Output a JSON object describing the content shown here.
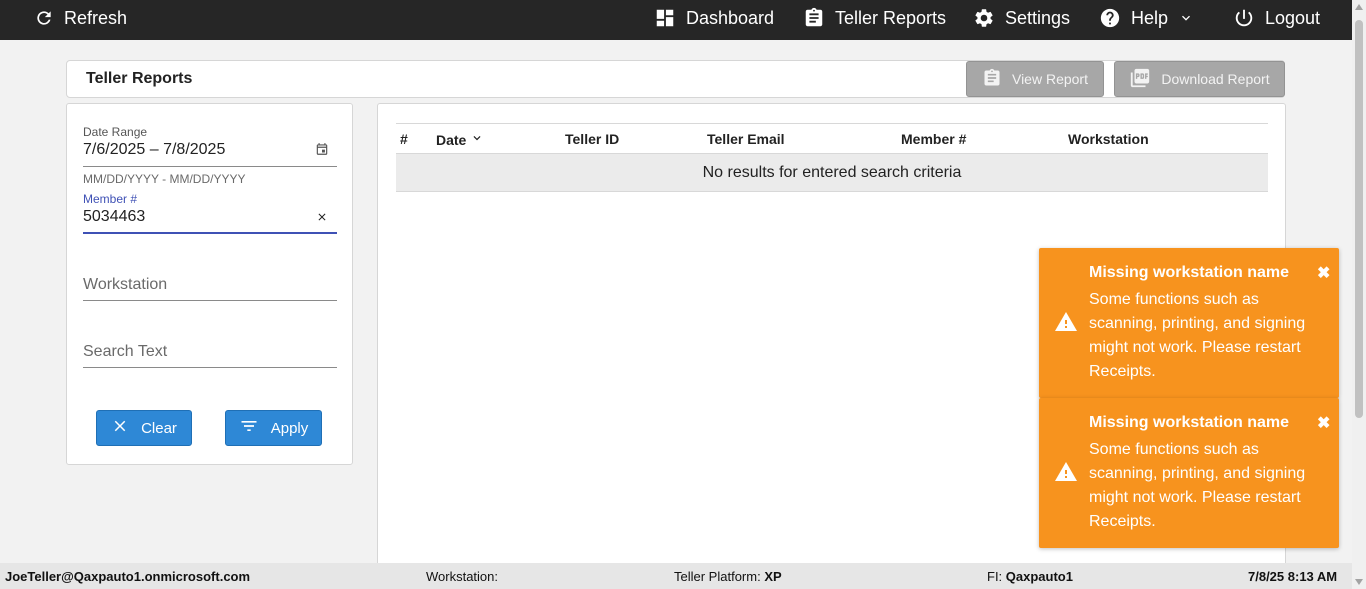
{
  "nav": {
    "refresh": "Refresh",
    "dashboard": "Dashboard",
    "teller_reports": "Teller Reports",
    "settings": "Settings",
    "help": "Help",
    "logout": "Logout"
  },
  "page": {
    "title": "Teller Reports",
    "view_report": "View Report",
    "download_report": "Download Report"
  },
  "filters": {
    "date_range_label": "Date Range",
    "date_range_value": "7/6/2025 – 7/8/2025",
    "date_range_hint": "MM/DD/YYYY - MM/DD/YYYY",
    "member_label": "Member #",
    "member_value": "5034463",
    "workstation_placeholder": "Workstation",
    "search_placeholder": "Search Text",
    "clear_label": "Clear",
    "apply_label": "Apply"
  },
  "table": {
    "columns": [
      "#",
      "Date",
      "Teller ID",
      "Teller Email",
      "Member #",
      "Workstation"
    ],
    "empty_message": "No results for entered search criteria"
  },
  "toasts": [
    {
      "title": "Missing workstation name",
      "message": "Some functions such as scanning, printing, and signing might not work. Please restart Receipts.",
      "close": "✖"
    },
    {
      "title": "Missing workstation name",
      "message": "Some functions such as scanning, printing, and signing might not work. Please restart Receipts.",
      "close": "✖"
    }
  ],
  "status": {
    "user": "JoeTeller@Qaxpauto1.onmicrosoft.com",
    "workstation_label": "Workstation:",
    "workstation_value": "",
    "platform_label": "Teller Platform:",
    "platform_value": "XP",
    "fi_label": "FI:",
    "fi_value": "Qaxpauto1",
    "datetime": "7/8/25 8:13 AM"
  },
  "colors": {
    "topbar": "#262626",
    "primary_button": "#2e88d6",
    "toast": "#f7931e",
    "active_underline": "#3f51b5"
  }
}
